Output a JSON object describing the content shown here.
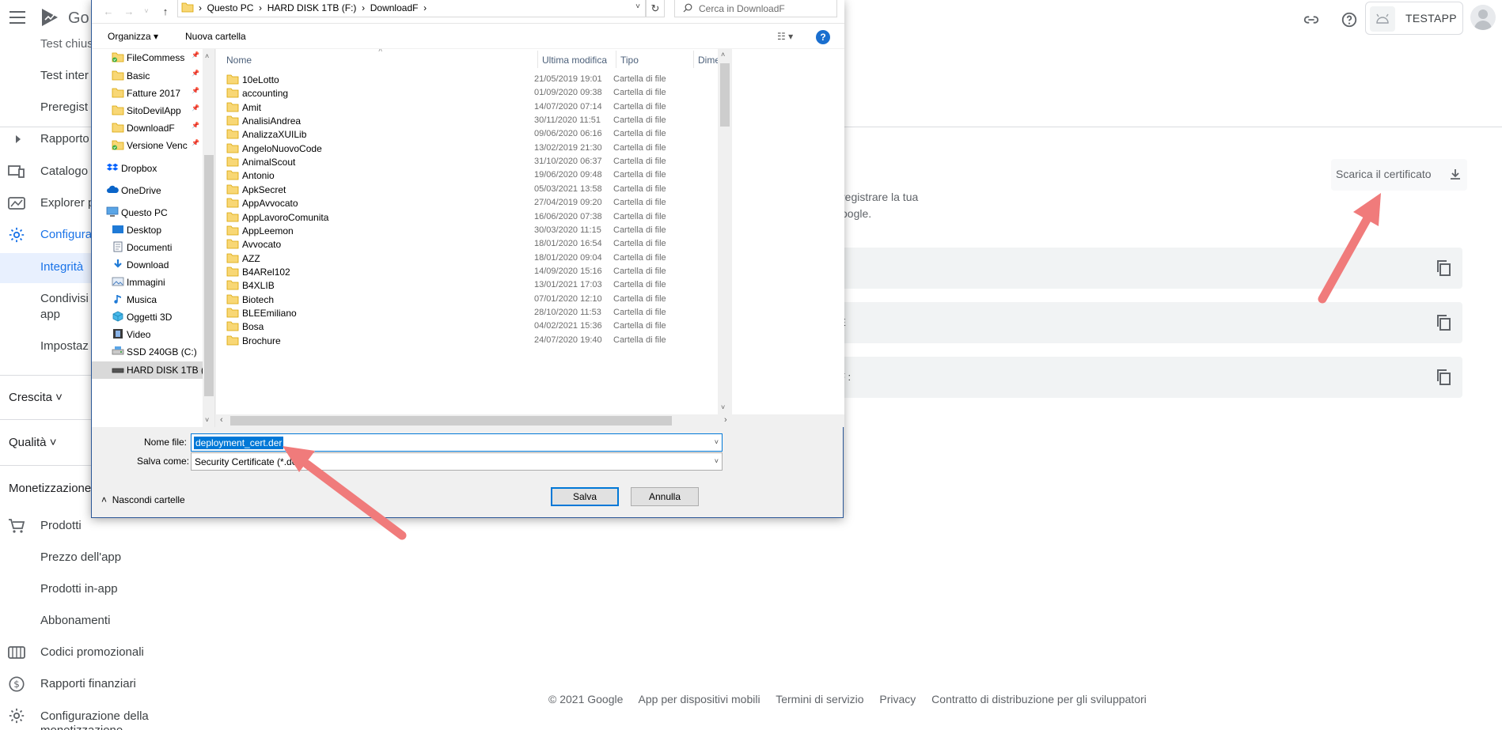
{
  "console": {
    "logo_partial": "Go",
    "app_name": "TESTAPP",
    "nav": {
      "top_partials": [
        "Test chius",
        "Test inter",
        "Preregist",
        "Rapporto",
        "Catalogo",
        "Explorer p",
        "Configura",
        "Integrità",
        "Condivisi",
        "app",
        "Impostaz"
      ],
      "crescita": "Crescita",
      "qualita": "Qualità",
      "monetizzazione": "Monetizzazione",
      "items": [
        "Prodotti",
        "Prezzo dell'app",
        "Prodotti in-app",
        "Abbonamenti",
        "Codici promozionali",
        "Rapporti finanziari",
        "Configurazione della",
        "monetizzazione"
      ]
    },
    "download_button": "Scarica il certificato",
    "desc_line1": "registrare la tua",
    "desc_line2": "oogle.",
    "cert_rows": [
      "",
      "E",
      "F :"
    ],
    "footer": [
      "© 2021 Google",
      "App per dispositivi mobili",
      "Termini di servizio",
      "Privacy",
      "Contratto di distribuzione per gli sviluppatori"
    ]
  },
  "dialog": {
    "breadcrumb": [
      "Questo PC",
      "HARD DISK 1TB (F:)",
      "DownloadF"
    ],
    "search_placeholder": "Cerca in DownloadF",
    "toolbar": {
      "organize": "Organizza",
      "new_folder": "Nuova cartella"
    },
    "tree": [
      {
        "label": "FileCommess",
        "icon": "folder-check",
        "pin": true
      },
      {
        "label": "Basic",
        "icon": "folder",
        "pin": true
      },
      {
        "label": "Fatture 2017",
        "icon": "folder",
        "pin": true
      },
      {
        "label": "SitoDevilApp",
        "icon": "folder",
        "pin": true
      },
      {
        "label": "DownloadF",
        "icon": "folder",
        "pin": true
      },
      {
        "label": "Versione Venc",
        "icon": "folder-check",
        "pin": true
      },
      {
        "label": "Dropbox",
        "icon": "dropbox"
      },
      {
        "label": "OneDrive",
        "icon": "cloud"
      },
      {
        "label": "Questo PC",
        "icon": "monitor"
      },
      {
        "label": "Desktop",
        "icon": "desktop"
      },
      {
        "label": "Documenti",
        "icon": "document"
      },
      {
        "label": "Download",
        "icon": "download-arrow"
      },
      {
        "label": "Immagini",
        "icon": "image"
      },
      {
        "label": "Musica",
        "icon": "music-note"
      },
      {
        "label": "Oggetti 3D",
        "icon": "cube"
      },
      {
        "label": "Video",
        "icon": "film"
      },
      {
        "label": "SSD 240GB (C:)",
        "icon": "drive"
      },
      {
        "label": "HARD DISK 1TB (",
        "icon": "drive-dark",
        "selected": true
      }
    ],
    "columns": {
      "name": "Nome",
      "modified": "Ultima modifica",
      "type": "Tipo",
      "size": "Dime"
    },
    "files": [
      {
        "name": "10eLotto",
        "date": "21/05/2019 19:01",
        "type": "Cartella di file"
      },
      {
        "name": "accounting",
        "date": "01/09/2020 09:38",
        "type": "Cartella di file"
      },
      {
        "name": "Amit",
        "date": "14/07/2020 07:14",
        "type": "Cartella di file"
      },
      {
        "name": "AnalisiAndrea",
        "date": "30/11/2020 11:51",
        "type": "Cartella di file"
      },
      {
        "name": "AnalizzaXUILib",
        "date": "09/06/2020 06:16",
        "type": "Cartella di file"
      },
      {
        "name": "AngeloNuovoCode",
        "date": "13/02/2019 21:30",
        "type": "Cartella di file"
      },
      {
        "name": "AnimalScout",
        "date": "31/10/2020 06:37",
        "type": "Cartella di file"
      },
      {
        "name": "Antonio",
        "date": "19/06/2020 09:48",
        "type": "Cartella di file"
      },
      {
        "name": "ApkSecret",
        "date": "05/03/2021 13:58",
        "type": "Cartella di file"
      },
      {
        "name": "AppAvvocato",
        "date": "27/04/2019 09:20",
        "type": "Cartella di file"
      },
      {
        "name": "AppLavoroComunita",
        "date": "16/06/2020 07:38",
        "type": "Cartella di file"
      },
      {
        "name": "AppLeemon",
        "date": "30/03/2020 11:15",
        "type": "Cartella di file"
      },
      {
        "name": "Avvocato",
        "date": "18/01/2020 16:54",
        "type": "Cartella di file"
      },
      {
        "name": "AZZ",
        "date": "18/01/2020 09:04",
        "type": "Cartella di file"
      },
      {
        "name": "B4ARel102",
        "date": "14/09/2020 15:16",
        "type": "Cartella di file"
      },
      {
        "name": "B4XLIB",
        "date": "13/01/2021 17:03",
        "type": "Cartella di file"
      },
      {
        "name": "Biotech",
        "date": "07/01/2020 12:10",
        "type": "Cartella di file"
      },
      {
        "name": "BLEEmiliano",
        "date": "28/10/2020 11:53",
        "type": "Cartella di file"
      },
      {
        "name": "Bosa",
        "date": "04/02/2021 15:36",
        "type": "Cartella di file"
      },
      {
        "name": "Brochure",
        "date": "24/07/2020 19:40",
        "type": "Cartella di file"
      }
    ],
    "filename_label": "Nome file:",
    "filename_value": "deployment_cert.der",
    "savetype_label": "Salva come:",
    "savetype_value": "Security Certificate (*.der)",
    "hide_folders": "Nascondi cartelle",
    "save_button": "Salva",
    "cancel_button": "Annulla"
  },
  "colors": {
    "accent": "#1a73e8",
    "arrow": "#f07b7b",
    "win_blue": "#0078d7"
  }
}
